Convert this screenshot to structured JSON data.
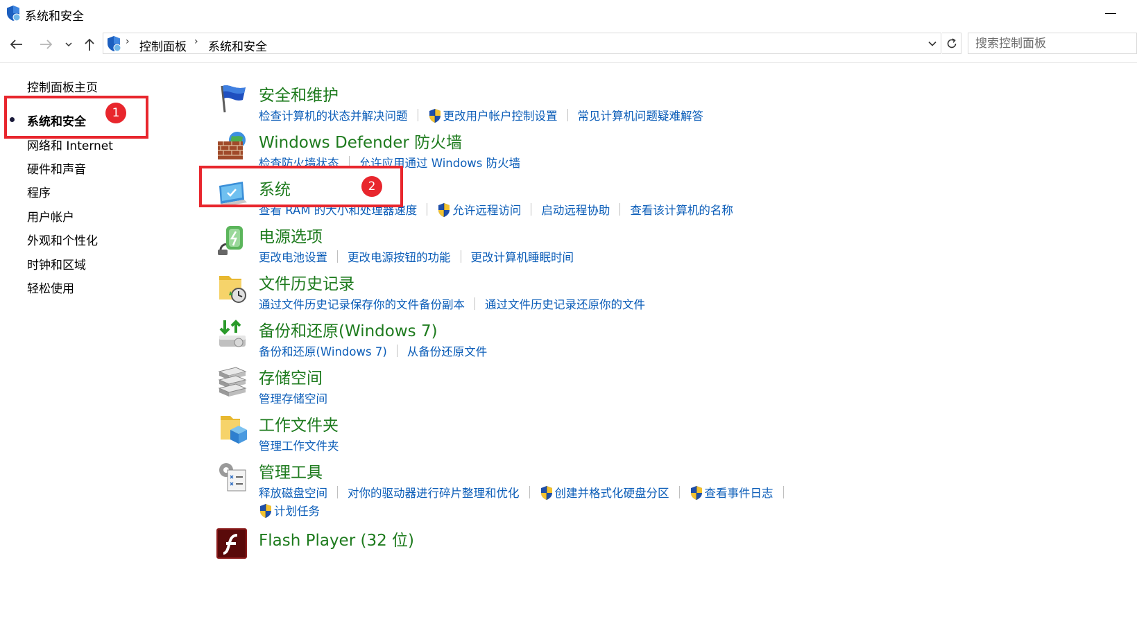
{
  "window": {
    "title": "系统和安全"
  },
  "address": {
    "crumbs": [
      "控制面板",
      "系统和安全"
    ],
    "search_placeholder": "搜索控制面板"
  },
  "sidebar": {
    "items": [
      {
        "label": "控制面板主页"
      },
      {
        "label": "系统和安全"
      },
      {
        "label": "网络和 Internet"
      },
      {
        "label": "硬件和声音"
      },
      {
        "label": "程序"
      },
      {
        "label": "用户帐户"
      },
      {
        "label": "外观和个性化"
      },
      {
        "label": "时钟和区域"
      },
      {
        "label": "轻松使用"
      }
    ]
  },
  "annotations": {
    "badge1": "1",
    "badge2": "2"
  },
  "categories": [
    {
      "title": "安全和维护",
      "links": [
        {
          "label": "检查计算机的状态并解决问题"
        },
        {
          "label": "更改用户帐户控制设置"
        },
        {
          "label": "常见计算机问题疑难解答"
        }
      ]
    },
    {
      "title": "Windows Defender 防火墙",
      "links": [
        {
          "label": "检查防火墙状态"
        },
        {
          "label": "允许应用通过 Windows 防火墙"
        }
      ]
    },
    {
      "title": "系统",
      "links": [
        {
          "label": "查看 RAM 的大小和处理器速度"
        },
        {
          "label": "允许远程访问"
        },
        {
          "label": "启动远程协助"
        },
        {
          "label": "查看该计算机的名称"
        }
      ]
    },
    {
      "title": "电源选项",
      "links": [
        {
          "label": "更改电池设置"
        },
        {
          "label": "更改电源按钮的功能"
        },
        {
          "label": "更改计算机睡眠时间"
        }
      ]
    },
    {
      "title": "文件历史记录",
      "links": [
        {
          "label": "通过文件历史记录保存你的文件备份副本"
        },
        {
          "label": "通过文件历史记录还原你的文件"
        }
      ]
    },
    {
      "title": "备份和还原(Windows 7)",
      "links": [
        {
          "label": "备份和还原(Windows 7)"
        },
        {
          "label": "从备份还原文件"
        }
      ]
    },
    {
      "title": "存储空间",
      "links": [
        {
          "label": "管理存储空间"
        }
      ]
    },
    {
      "title": "工作文件夹",
      "links": [
        {
          "label": "管理工作文件夹"
        }
      ]
    },
    {
      "title": "管理工具",
      "links": [
        {
          "label": "释放磁盘空间"
        },
        {
          "label": "对你的驱动器进行碎片整理和优化"
        },
        {
          "label": "创建并格式化硬盘分区"
        },
        {
          "label": "查看事件日志"
        },
        {
          "label": "计划任务"
        }
      ]
    },
    {
      "title": "Flash Player (32 位)",
      "links": []
    }
  ]
}
